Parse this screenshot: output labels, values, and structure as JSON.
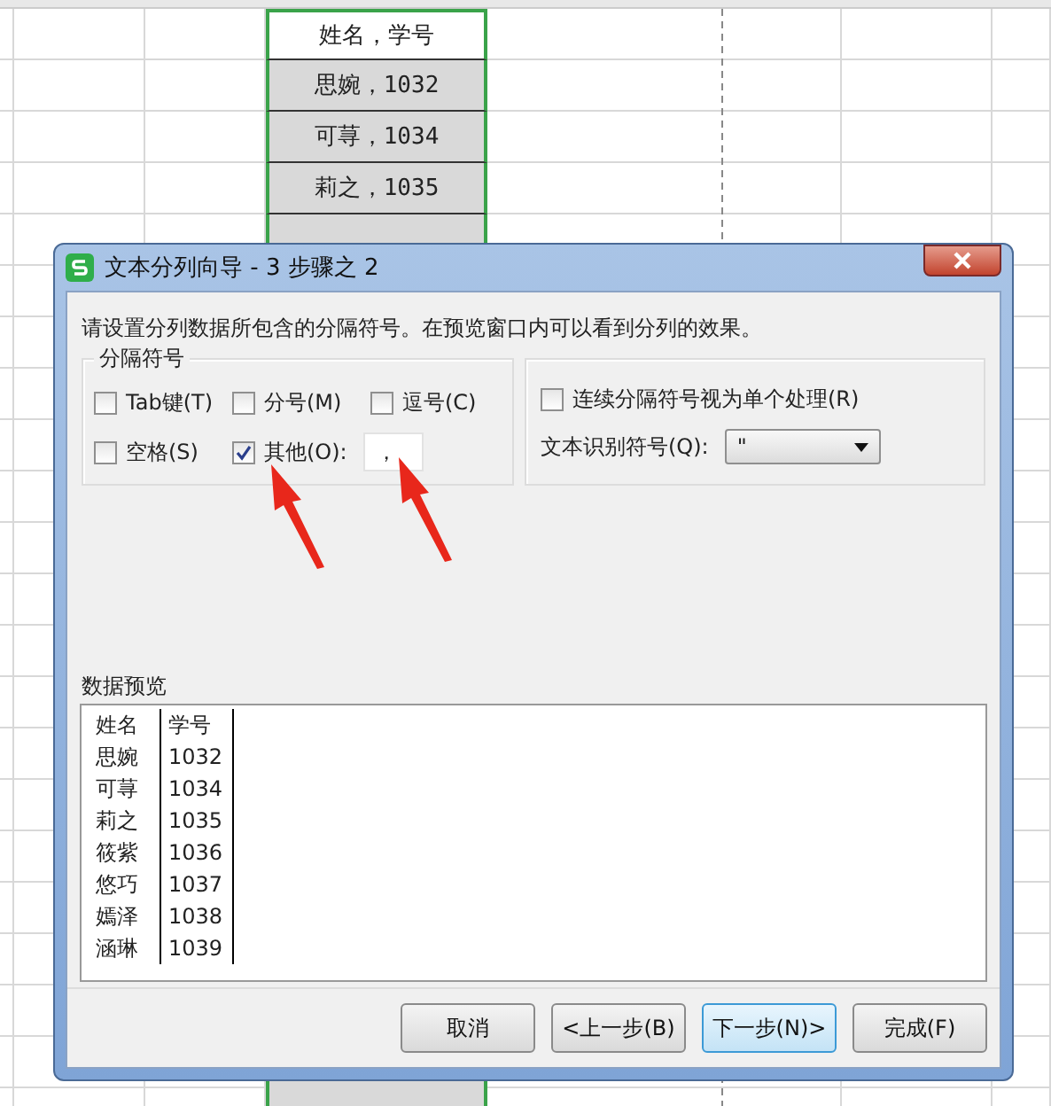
{
  "sheet": {
    "cells": [
      {
        "text": "姓名，学号",
        "active": true
      },
      {
        "text": "思婉，1032",
        "active": false
      },
      {
        "text": "可荨，1034",
        "active": false
      },
      {
        "text": "莉之，1035",
        "active": false
      }
    ]
  },
  "dialog": {
    "title": "文本分列向导 - 3 步骤之 2",
    "instruction": "请设置分列数据所包含的分隔符号。在预览窗口内可以看到分列的效果。",
    "delimiters": {
      "title": "分隔符号",
      "options": [
        {
          "kind": "checkbox",
          "label": "Tab键(T)",
          "checked": false
        },
        {
          "kind": "checkbox",
          "label": "分号(M)",
          "checked": false
        },
        {
          "kind": "checkbox",
          "label": "逗号(C)",
          "checked": false
        },
        {
          "kind": "checkbox",
          "label": "空格(S)",
          "checked": false
        },
        {
          "kind": "other",
          "label": "其他(O):",
          "checked": true
        }
      ],
      "other_field": "，"
    },
    "consecutive": {
      "label": "连续分隔符号视为单个处理(R)",
      "checked": false
    },
    "qualifier": {
      "label": "文本识别符号(Q):",
      "value": "\""
    },
    "preview": {
      "title": "数据预览",
      "rows": [
        [
          "姓名",
          "学号"
        ],
        [
          "思婉",
          "1032"
        ],
        [
          "可荨",
          "1034"
        ],
        [
          "莉之",
          "1035"
        ],
        [
          "筱紫",
          "1036"
        ],
        [
          "悠巧",
          "1037"
        ],
        [
          "嫣泽",
          "1038"
        ],
        [
          "涵琳",
          "1039"
        ]
      ]
    },
    "buttons": [
      {
        "label": "取消",
        "default": false
      },
      {
        "label": "<上一步(B)",
        "default": false
      },
      {
        "label": "下一步(N)>",
        "default": true
      },
      {
        "label": "完成(F)",
        "default": false
      }
    ]
  }
}
